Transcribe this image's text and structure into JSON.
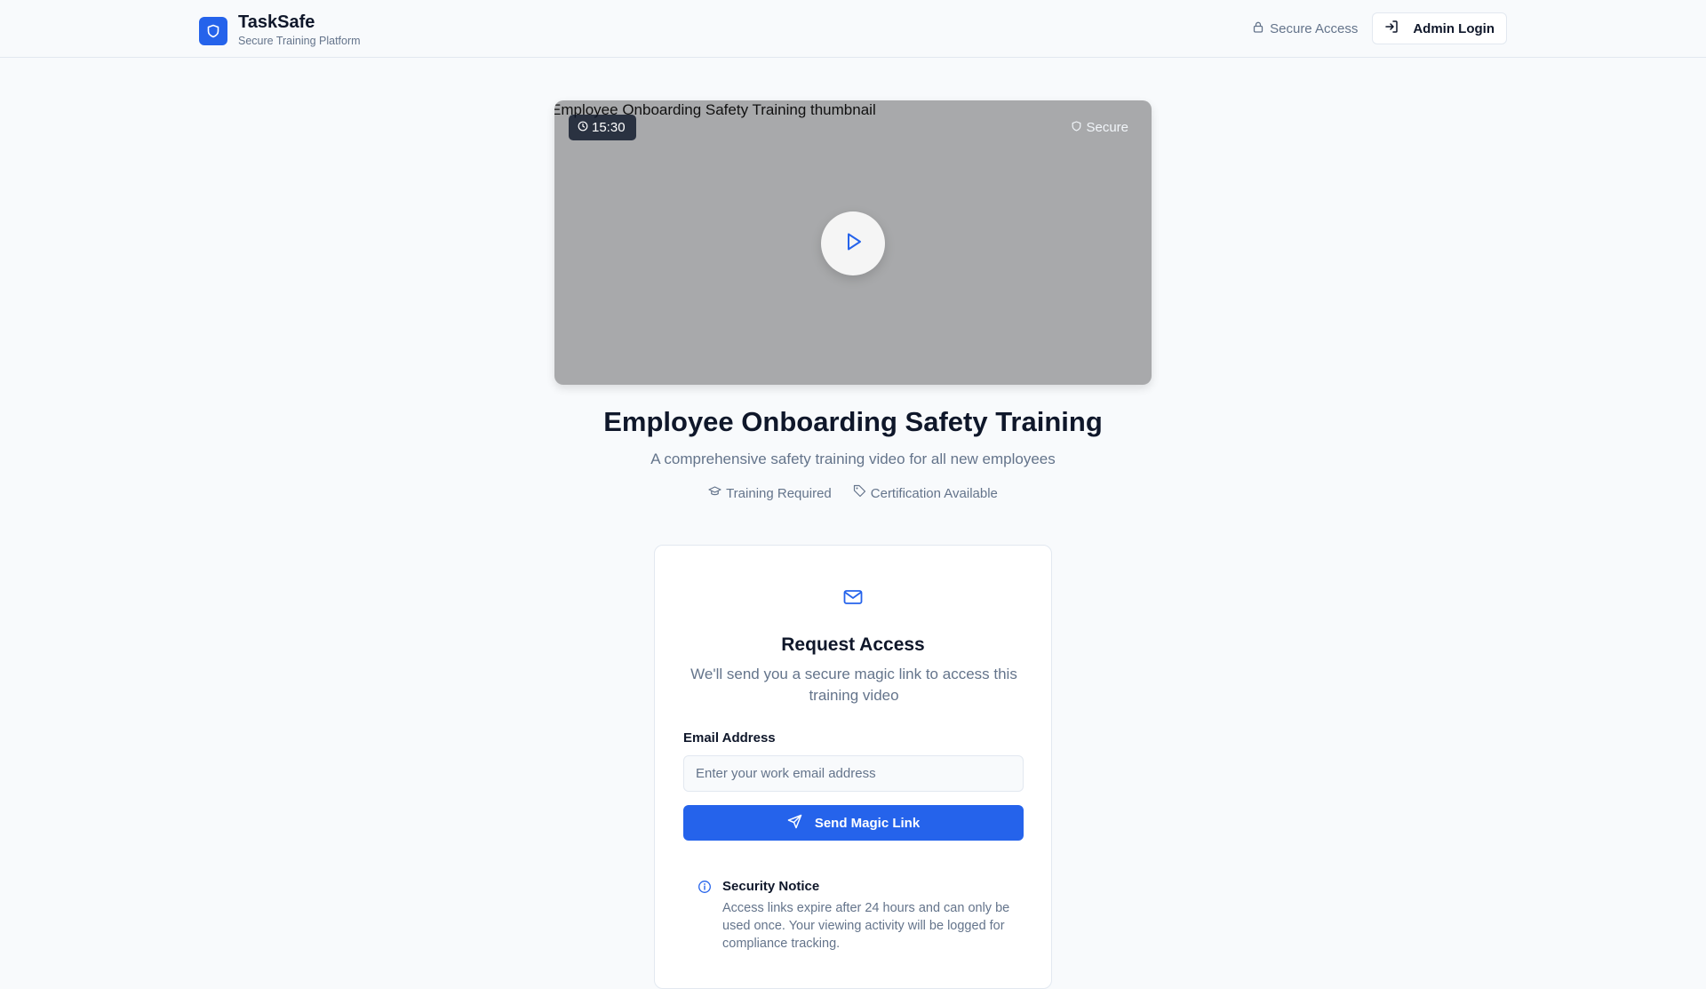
{
  "header": {
    "brand_name": "TaskSafe",
    "brand_subtitle": "Secure Training Platform",
    "secure_access_label": "Secure Access",
    "admin_login_label": "Admin Login"
  },
  "video": {
    "thumbnail_alt": "Employee Onboarding Safety Training thumbnail",
    "duration": "15:30",
    "secure_label": "Secure"
  },
  "training": {
    "title": "Employee Onboarding Safety Training",
    "subtitle": "A comprehensive safety training video for all new employees",
    "tags": [
      "Training Required",
      "Certification Available"
    ]
  },
  "request_access": {
    "title": "Request Access",
    "description": "We'll send you a secure magic link to access this training video",
    "email_label": "Email Address",
    "email_placeholder": "Enter your work email address",
    "email_value": "",
    "send_button_label": "Send Magic Link",
    "notice_title": "Security Notice",
    "notice_text": "Access links expire after 24 hours and can only be used once. Your viewing activity will be logged for compliance tracking."
  },
  "colors": {
    "accent": "#2563eb",
    "background": "#f8fafc",
    "muted_text": "#64748b"
  },
  "icons": {
    "brand": "shield-icon",
    "secure_access": "lock-icon",
    "admin_login": "login-icon",
    "duration": "clock-icon",
    "secure": "shield-icon",
    "play": "play-icon",
    "training_required": "graduation-cap-icon",
    "certification": "tag-icon",
    "request": "mail-icon",
    "send": "send-icon",
    "notice": "info-icon"
  }
}
